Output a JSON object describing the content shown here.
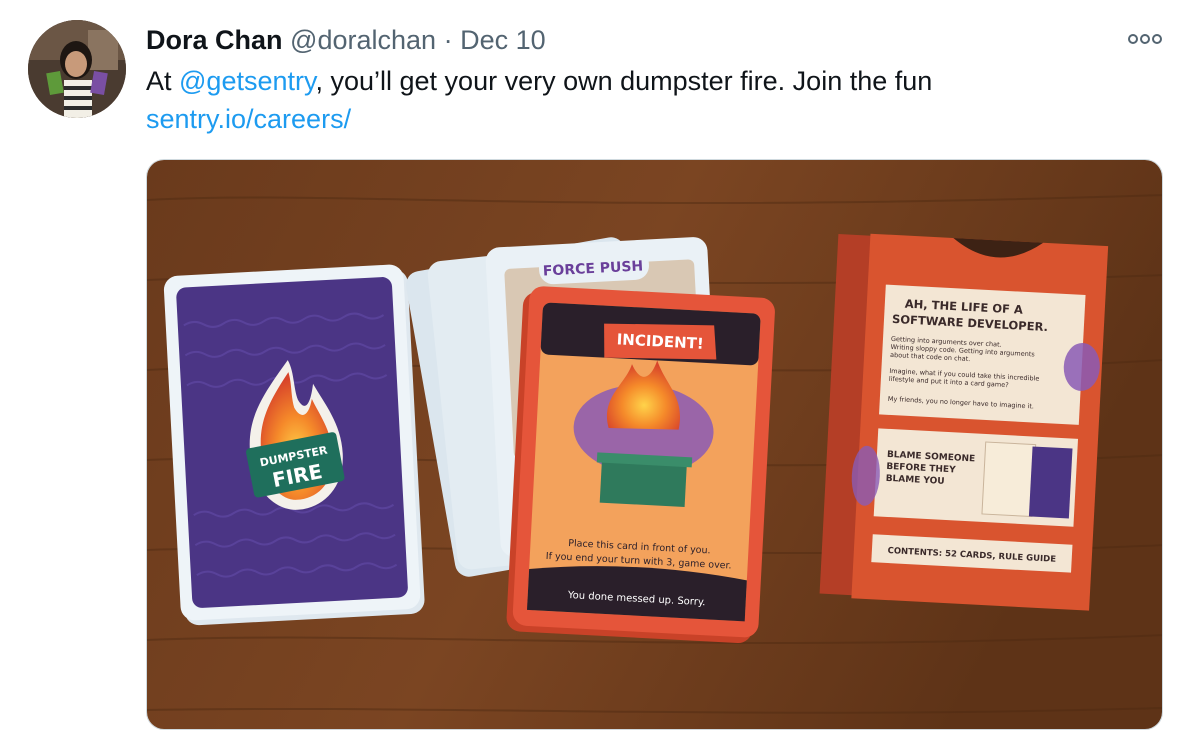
{
  "tweet": {
    "author_name": "Dora Chan",
    "author_handle": "@doralchan",
    "separator": "·",
    "date": "Dec 10",
    "text_prefix": "At ",
    "mention": "@getsentry",
    "text_body": ", you’ll get your very own dumpster fire. Join the fun",
    "link": "sentry.io/careers/"
  },
  "icons": {
    "more": "more-options-icon"
  },
  "colors": {
    "link": "#1d9bf0",
    "secondary_text": "#536471",
    "primary_text": "#0f1419"
  },
  "photo": {
    "card_back_title_top": "DUMPSTER",
    "card_back_title_bottom": "FIRE",
    "card_force_push": "FORCE PUSH",
    "card_incident_title": "INCIDENT!",
    "card_incident_text_1": "Place this card in front of you.",
    "card_incident_text_2": "If you end your turn with 3, game over.",
    "card_incident_footer": "You done messed up. Sorry.",
    "box_heading_1": "AH, THE LIFE OF A",
    "box_heading_2": "SOFTWARE DEVELOPER.",
    "box_para_1a": "Getting into arguments over chat.",
    "box_para_1b": "Writing sloppy code. Getting into arguments",
    "box_para_1c": "about that code on chat.",
    "box_para_2a": "Imagine, what if you could take this incredible",
    "box_para_2b": "lifestyle and put it into a card game?",
    "box_para_3": "My friends, you no longer have to imagine it.",
    "box_blame_1": "BLAME SOMEONE",
    "box_blame_2": "BEFORE THEY",
    "box_blame_3": "BLAME YOU",
    "box_contents": "CONTENTS: 52 CARDS, RULE GUIDE"
  }
}
